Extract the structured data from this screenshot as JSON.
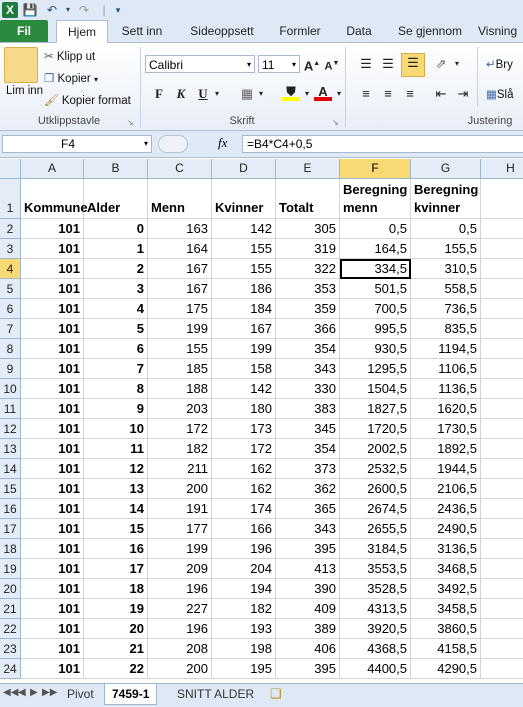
{
  "ribbon_tabs": [
    "Fil",
    "Hjem",
    "Sett inn",
    "Sideoppsett",
    "Formler",
    "Data",
    "Se gjennom",
    "Visning"
  ],
  "clipboard": {
    "paste": "Lim inn",
    "cut": "Klipp ut",
    "copy": "Kopier",
    "format_painter": "Kopier format",
    "group": "Utklippstavle"
  },
  "font": {
    "name": "Calibri",
    "size": "11",
    "group": "Skrift"
  },
  "alignment": {
    "wrap": "Bry",
    "merge": "Slå",
    "group": "Justering"
  },
  "formula_bar": {
    "cell_ref": "F4",
    "fx": "fx",
    "formula": "=B4*C4+0,5"
  },
  "columns": [
    "A",
    "B",
    "C",
    "D",
    "E",
    "F",
    "G",
    "H"
  ],
  "selected_column": "F",
  "header_row": {
    "row": "1",
    "A": "Kommune",
    "B": "Alder",
    "C": "Menn",
    "D": "Kvinner",
    "E": "Totalt",
    "F1": "Beregning",
    "F2": "menn",
    "G1": "Beregning",
    "G2": "kvinner"
  },
  "rows": [
    {
      "row": "2",
      "A": "101",
      "B": "0",
      "C": "163",
      "D": "142",
      "E": "305",
      "F": "0,5",
      "G": "0,5"
    },
    {
      "row": "3",
      "A": "101",
      "B": "1",
      "C": "164",
      "D": "155",
      "E": "319",
      "F": "164,5",
      "G": "155,5"
    },
    {
      "row": "4",
      "A": "101",
      "B": "2",
      "C": "167",
      "D": "155",
      "E": "322",
      "F": "334,5",
      "G": "310,5"
    },
    {
      "row": "5",
      "A": "101",
      "B": "3",
      "C": "167",
      "D": "186",
      "E": "353",
      "F": "501,5",
      "G": "558,5"
    },
    {
      "row": "6",
      "A": "101",
      "B": "4",
      "C": "175",
      "D": "184",
      "E": "359",
      "F": "700,5",
      "G": "736,5"
    },
    {
      "row": "7",
      "A": "101",
      "B": "5",
      "C": "199",
      "D": "167",
      "E": "366",
      "F": "995,5",
      "G": "835,5"
    },
    {
      "row": "8",
      "A": "101",
      "B": "6",
      "C": "155",
      "D": "199",
      "E": "354",
      "F": "930,5",
      "G": "1194,5"
    },
    {
      "row": "9",
      "A": "101",
      "B": "7",
      "C": "185",
      "D": "158",
      "E": "343",
      "F": "1295,5",
      "G": "1106,5"
    },
    {
      "row": "10",
      "A": "101",
      "B": "8",
      "C": "188",
      "D": "142",
      "E": "330",
      "F": "1504,5",
      "G": "1136,5"
    },
    {
      "row": "11",
      "A": "101",
      "B": "9",
      "C": "203",
      "D": "180",
      "E": "383",
      "F": "1827,5",
      "G": "1620,5"
    },
    {
      "row": "12",
      "A": "101",
      "B": "10",
      "C": "172",
      "D": "173",
      "E": "345",
      "F": "1720,5",
      "G": "1730,5"
    },
    {
      "row": "13",
      "A": "101",
      "B": "11",
      "C": "182",
      "D": "172",
      "E": "354",
      "F": "2002,5",
      "G": "1892,5"
    },
    {
      "row": "14",
      "A": "101",
      "B": "12",
      "C": "211",
      "D": "162",
      "E": "373",
      "F": "2532,5",
      "G": "1944,5"
    },
    {
      "row": "15",
      "A": "101",
      "B": "13",
      "C": "200",
      "D": "162",
      "E": "362",
      "F": "2600,5",
      "G": "2106,5"
    },
    {
      "row": "16",
      "A": "101",
      "B": "14",
      "C": "191",
      "D": "174",
      "E": "365",
      "F": "2674,5",
      "G": "2436,5"
    },
    {
      "row": "17",
      "A": "101",
      "B": "15",
      "C": "177",
      "D": "166",
      "E": "343",
      "F": "2655,5",
      "G": "2490,5"
    },
    {
      "row": "18",
      "A": "101",
      "B": "16",
      "C": "199",
      "D": "196",
      "E": "395",
      "F": "3184,5",
      "G": "3136,5"
    },
    {
      "row": "19",
      "A": "101",
      "B": "17",
      "C": "209",
      "D": "204",
      "E": "413",
      "F": "3553,5",
      "G": "3468,5"
    },
    {
      "row": "20",
      "A": "101",
      "B": "18",
      "C": "196",
      "D": "194",
      "E": "390",
      "F": "3528,5",
      "G": "3492,5"
    },
    {
      "row": "21",
      "A": "101",
      "B": "19",
      "C": "227",
      "D": "182",
      "E": "409",
      "F": "4313,5",
      "G": "3458,5"
    },
    {
      "row": "22",
      "A": "101",
      "B": "20",
      "C": "196",
      "D": "193",
      "E": "389",
      "F": "3920,5",
      "G": "3860,5"
    },
    {
      "row": "23",
      "A": "101",
      "B": "21",
      "C": "208",
      "D": "198",
      "E": "406",
      "F": "4368,5",
      "G": "4158,5"
    },
    {
      "row": "24",
      "A": "101",
      "B": "22",
      "C": "200",
      "D": "195",
      "E": "395",
      "F": "4400,5",
      "G": "4290,5"
    }
  ],
  "active_cell": "F4",
  "sheets": [
    "Pivot",
    "7459-1",
    "SNITT ALDER"
  ],
  "active_sheet": "7459-1"
}
